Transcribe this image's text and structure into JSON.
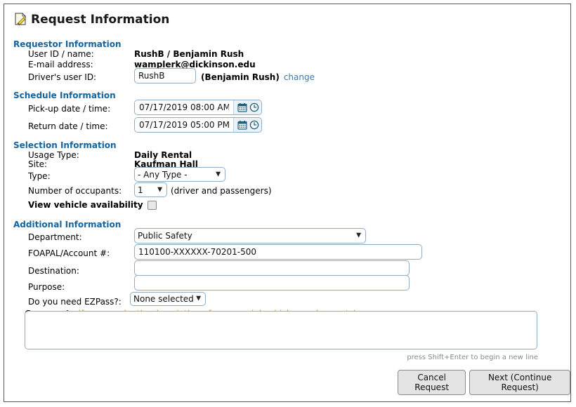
{
  "page": {
    "title": "Request Information",
    "title_icon": "document-pencil-icon"
  },
  "requestor": {
    "header": "Requestor Information",
    "user_id_label": "User ID / name:",
    "user_id_value": "RushB / Benjamin Rush",
    "email_label": "E-mail address:",
    "email_value": "wamplerk@dickinson.edu",
    "driver_label": "Driver's user ID:",
    "driver_value": "RushB",
    "driver_name": "(Benjamin Rush)",
    "change_link": "change"
  },
  "schedule": {
    "header": "Schedule Information",
    "pickup_label": "Pick-up date / time:",
    "pickup_value": "07/17/2019 08:00 AM",
    "return_label": "Return date / time:",
    "return_value": "07/17/2019 05:00 PM",
    "calendar_icon": "calendar-icon",
    "clock_icon": "clock-icon"
  },
  "selection": {
    "header": "Selection Information",
    "usage_label": "Usage Type:",
    "usage_value": "Daily Rental",
    "site_label": "Site:",
    "site_value": "Kaufman Hall",
    "type_label": "Type:",
    "type_value": "- Any Type -",
    "type_options": [
      "- Any Type -"
    ],
    "occupants_label": "Number of occupants:",
    "occupants_value": "1",
    "occupants_options": [
      "1"
    ],
    "occupants_note": "(driver and passengers)",
    "availability_label": "View vehicle availability",
    "availability_checked": false
  },
  "additional": {
    "header": "Additional Information",
    "department_label": "Department:",
    "department_value": "Public Safety",
    "department_options": [
      "Public Safety"
    ],
    "foapal_label": "FOAPAL/Account #:",
    "foapal_value": "110100-XXXXXX-70201-500",
    "destination_label": "Destination:",
    "destination_value": "",
    "purpose_label": "Purpose:",
    "purpose_value": "",
    "ezpass_label": "Do you need EZPass?:",
    "ezpass_value": "None selected",
    "ezpass_options": [
      "None selected"
    ],
    "comments_label": "Comments",
    "comments_hint": "(for example, the description of any special vehicle requirements)",
    "comments_value": "",
    "comments_footnote": "press Shift+Enter to begin a new line"
  },
  "actions": {
    "cancel_label": "Cancel Request",
    "next_label": "Next (Continue Request)"
  },
  "colors": {
    "section_header": "#1464a0",
    "link": "#3b7ab5",
    "hint": "#d99a16",
    "input_border": "#8fadc4"
  }
}
